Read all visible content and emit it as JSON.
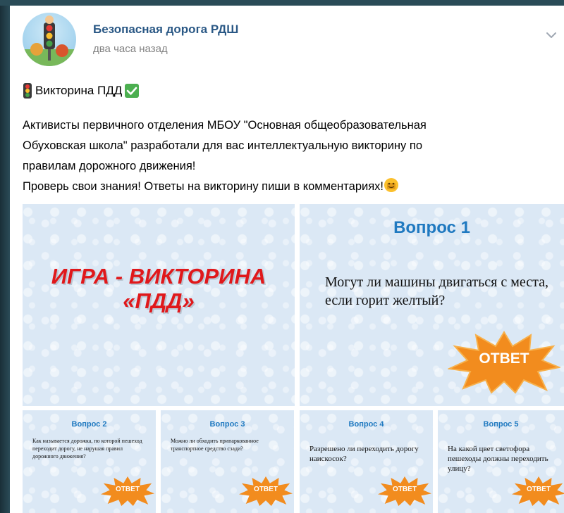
{
  "post": {
    "author": "Безопасная дорога РДШ",
    "time": "два часа назад",
    "title": "Викторина ПДД",
    "body_lines": [
      "Активисты первичного отделения МБОУ \"Основная общеобразовательная",
      "Обуховская школа\" разработали для вас интеллектуальную викторину по",
      "правилам дорожного движения!",
      "Проверь свои знания! Ответы на викторину пиши в комментариях!"
    ]
  },
  "gallery": {
    "main": {
      "line1": "ИГРА  - ВИКТОРИНА",
      "line2": "«ПДД»"
    },
    "q1": {
      "heading": "Вопрос 1",
      "text": "Могут ли машины двигаться с места, если горит желтый?",
      "answer": "ОТВЕТ"
    },
    "q2": {
      "heading": "Вопрос 2",
      "text": "Как называется дорожка, по которой пешеход переходит дорогу, не нарушая правил дорожного движения?",
      "answer": "ОТВЕТ"
    },
    "q3": {
      "heading": "Вопрос 3",
      "text": "Можно ли обходить припаркованное транспортное средство сзади?",
      "answer": "ОТВЕТ"
    },
    "q4": {
      "heading": "Вопрос 4",
      "text": "Разрешено ли переходить дорогу наискосок?",
      "answer": "ОТВЕТ"
    },
    "q5": {
      "heading": "Вопрос 5",
      "text": "На какой цвет светофора пешеходы должны переходить улицу?",
      "answer": "ОТВЕТ"
    }
  },
  "icons": {
    "title_left": "traffic-light-icon",
    "title_right": "check-mark-icon",
    "body_end": "smiling-face-icon",
    "menu": "chevron-down-icon"
  },
  "colors": {
    "author": "#2a5885",
    "question_heading": "#1f79c0",
    "game_title": "#e0181b",
    "answer_burst": "#f28c1e"
  }
}
